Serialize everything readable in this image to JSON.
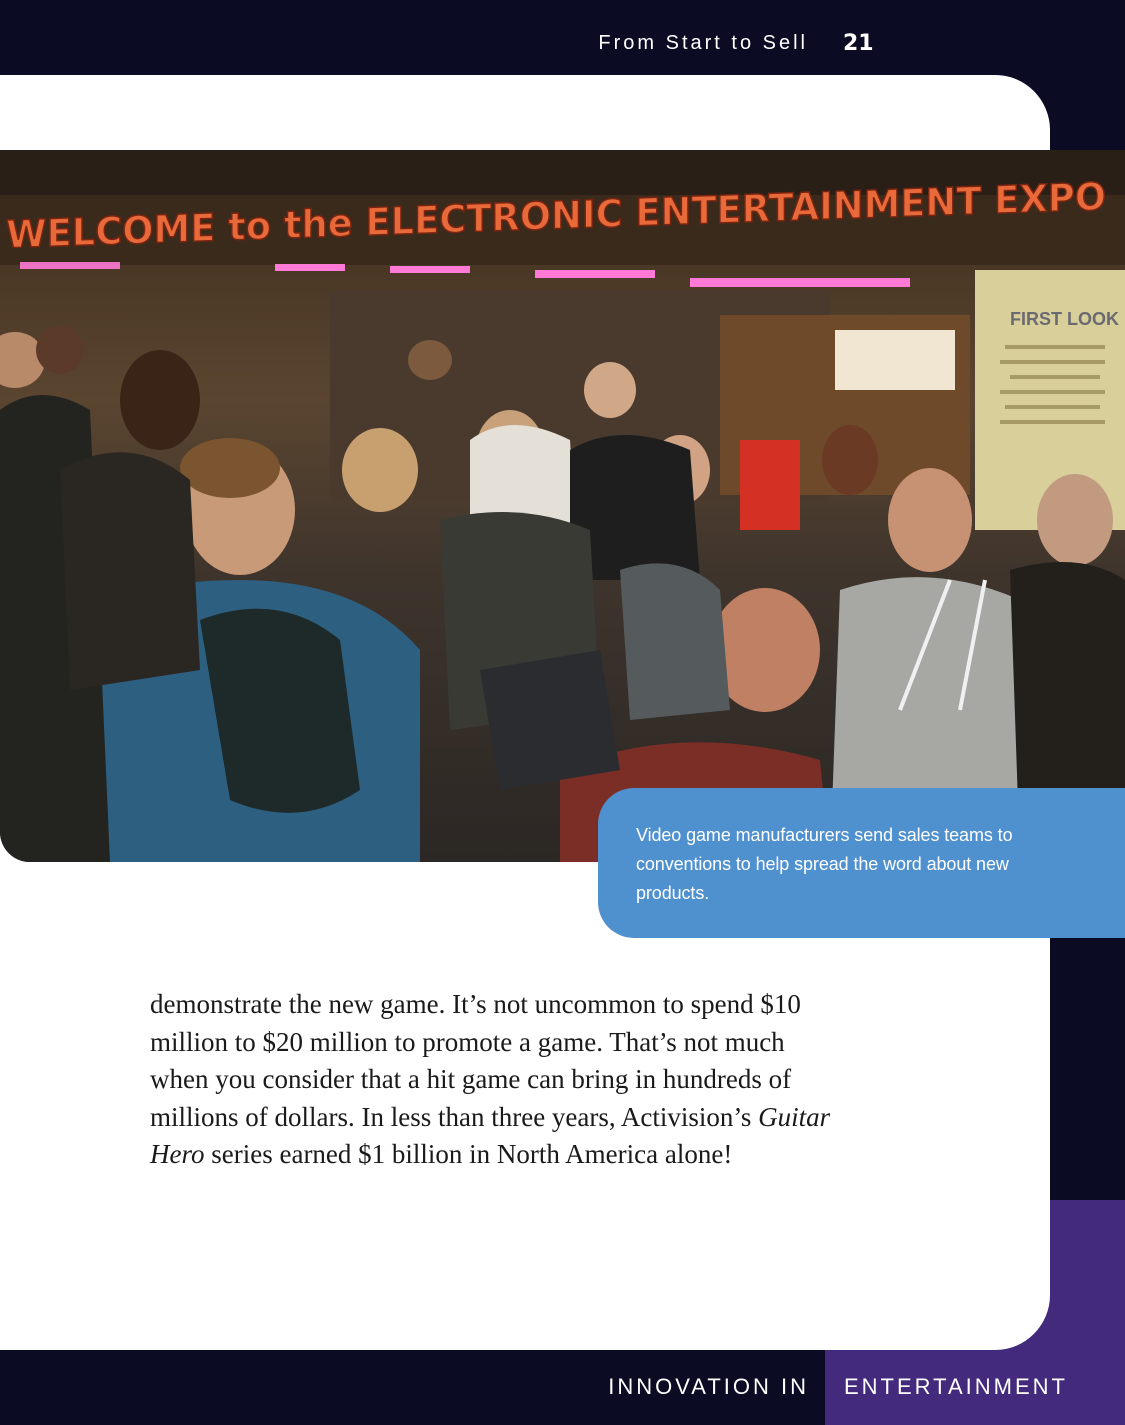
{
  "header": {
    "running_head": "From Start to Sell",
    "page_number": "21"
  },
  "photo": {
    "banner_text": "WELCOME to the ELECTRONIC ENTERTAINMENT EXPO",
    "sign_text": "FIRST LOOK"
  },
  "caption": {
    "text": "Video game manufacturers send sales teams to conventions to help spread the word about new products."
  },
  "body": {
    "before_title": "demonstrate the new game. It’s not uncommon to spend $10 million to $20 million to promote a game. That’s not much when you consider that a hit game can bring in hundreds of millions of dollars. In less than three years, Activision’s ",
    "title_italic": "Guitar Hero",
    "after_title": " series earned $1 billion in North America alone!"
  },
  "footer": {
    "left_label": "INNOVATION IN",
    "right_label": "ENTERTAINMENT"
  },
  "colors": {
    "navy": "#0b0b24",
    "purple": "#432a7d",
    "caption_blue": "#4f90cf",
    "page_white": "#ffffff"
  }
}
